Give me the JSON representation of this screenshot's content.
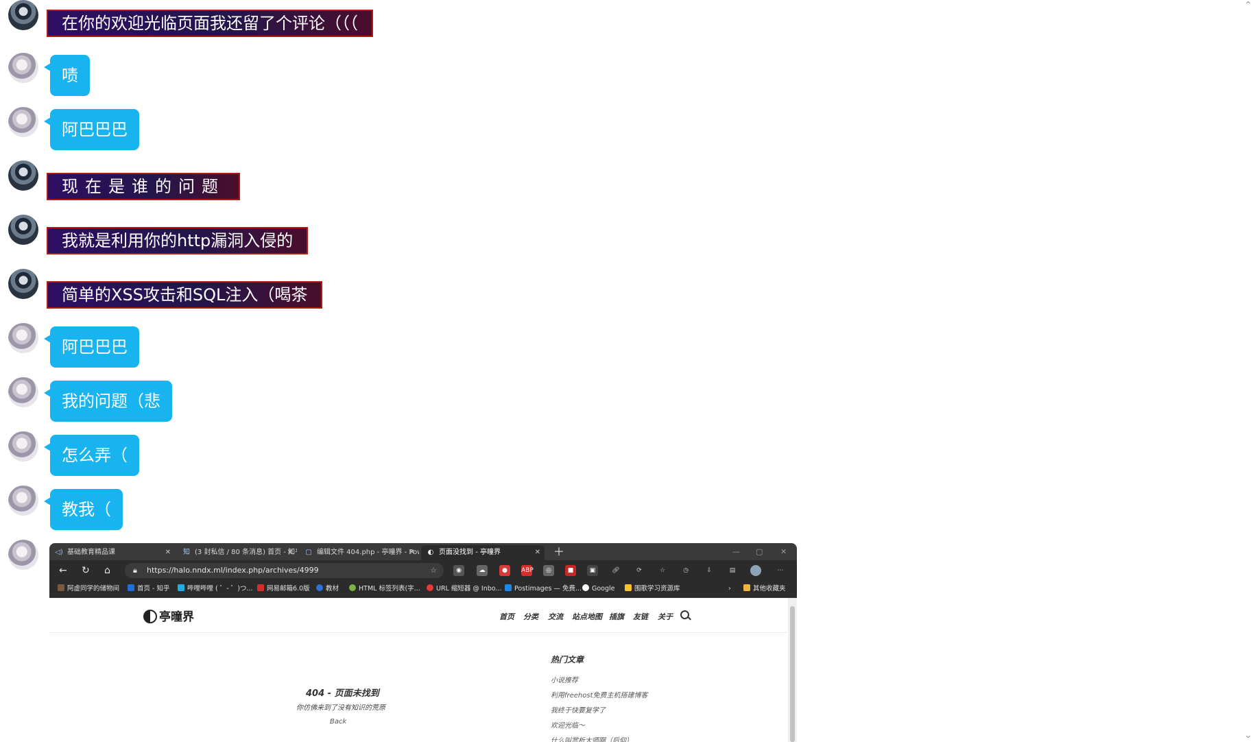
{
  "messages": [
    {
      "avatar": "dark",
      "style": "dark",
      "text": "在你的欢迎光临页面我还留了个评论（（（"
    },
    {
      "avatar": "light",
      "style": "blue",
      "text": "啧"
    },
    {
      "avatar": "light",
      "style": "blue",
      "text": "阿巴巴巴"
    },
    {
      "avatar": "dark",
      "style": "dark",
      "text": "现在是谁的问题"
    },
    {
      "avatar": "dark",
      "style": "dark",
      "text": "我就是利用你的http漏洞入侵的"
    },
    {
      "avatar": "dark",
      "style": "dark",
      "text": "简单的XSS攻击和SQL注入（喝茶"
    },
    {
      "avatar": "light",
      "style": "blue",
      "text": "阿巴巴巴"
    },
    {
      "avatar": "light",
      "style": "blue",
      "text": "我的问题（悲"
    },
    {
      "avatar": "light",
      "style": "blue",
      "text": "怎么弄（"
    },
    {
      "avatar": "light",
      "style": "blue",
      "text": "教我（"
    }
  ],
  "screenshot": {
    "tabs": [
      {
        "label": "基础教育精品课",
        "icon": "speaker-icon"
      },
      {
        "label": "(3 封私信 / 80 条消息) 首页 - 知乎",
        "icon": "zhihu-icon"
      },
      {
        "label": "编辑文件 404.php - 亭曈界 - Pow",
        "icon": "file-icon"
      },
      {
        "label": "页面没找到 - 亭曈界",
        "icon": "site-icon"
      }
    ],
    "url": "https://halo.nndx.ml/index.php/archives/4999",
    "bookmarks": [
      "阿虚同学的储物间",
      "首页 - 知乎",
      "哔哩哔哩 ( ゜- ゜)つ...",
      "网易邮箱6.0版",
      "教材",
      "HTML 标签列表(字...",
      "URL 缩短器 @ Inbo...",
      "Postimages — 免费...",
      "Google",
      "围歌学习资源库",
      "其他收藏夹"
    ],
    "site_logo": "亭曈界",
    "nav": [
      "首页",
      "分类",
      "交流",
      "站点地图",
      "插旗",
      "友链",
      "关于"
    ],
    "not_found_title": "404 - 页面未找到",
    "not_found_subtitle": "你仿佛来到了没有知识的荒原",
    "back_label": "Back",
    "hot_title": "热门文章",
    "hot_articles": [
      "小说推荐",
      "利用freehost免费主机搭建博客",
      "我终于快要复学了",
      "欢迎光临～",
      "什么叫赏析大师啊（后仰）"
    ]
  }
}
